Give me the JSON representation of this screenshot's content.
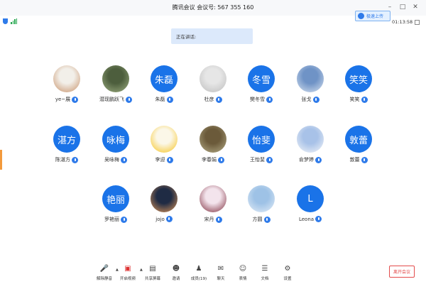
{
  "window": {
    "title": "腾讯会议 会议号: 567 355 160",
    "controls": [
      "minimize-icon",
      "maximize-icon",
      "close-icon"
    ]
  },
  "header": {
    "upload_button": "极速上传",
    "timer": "01:13:58",
    "speaking_label": "正在讲话:"
  },
  "participants": [
    {
      "name": "ye~展",
      "avatar": "photo-cartoon-child",
      "colors": [
        "#f2efe9",
        "#c68f66"
      ]
    },
    {
      "name": "潜现鹏跃飞",
      "avatar": "photo-forest",
      "colors": [
        "#4d5e3d",
        "#9fb083"
      ]
    },
    {
      "name": "朱磊",
      "avatar_text": "朱磊"
    },
    {
      "name": "杜彦",
      "avatar": "default-person",
      "colors": [
        "#e6e6e6",
        "#bdbdbd"
      ]
    },
    {
      "name": "樊冬雪",
      "avatar_text": "冬雪"
    },
    {
      "name": "张戈",
      "avatar": "photo-sky-clouds",
      "colors": [
        "#6f93c6",
        "#d9e3f0"
      ]
    },
    {
      "name": "笑笑",
      "avatar_text": "笑笑"
    },
    {
      "name": "陈湛方",
      "avatar_text": "湛方"
    },
    {
      "name": "吴咏梅",
      "avatar_text": "咏梅"
    },
    {
      "name": "李迎",
      "avatar": "photo-sun-cartoon",
      "colors": [
        "#fbf7e8",
        "#f6c21b"
      ]
    },
    {
      "name": "李春娟",
      "avatar": "photo-forest-trees",
      "colors": [
        "#6b5a3a",
        "#b6ae8a"
      ]
    },
    {
      "name": "王怡斐",
      "avatar_text": "怡斐"
    },
    {
      "name": "俞梦婷",
      "avatar": "photo-landmark-sky",
      "colors": [
        "#a8c2e8",
        "#f5f6f8"
      ]
    },
    {
      "name": "敦蕾",
      "avatar_text": "敦蕾"
    },
    {
      "name": "罗艳丽",
      "avatar_text": "艳丽"
    },
    {
      "name": "jojo",
      "avatar": "photo-sunset",
      "colors": [
        "#1f2b44",
        "#e39a5a"
      ]
    },
    {
      "name": "宋丹",
      "avatar": "photo-cartoon-girl",
      "colors": [
        "#f3e4ec",
        "#7b2a3a"
      ]
    },
    {
      "name": "方圆",
      "avatar": "photo-sky-blue",
      "colors": [
        "#9ec2e6",
        "#e5eef7"
      ]
    },
    {
      "name": "Leona",
      "avatar_text": "L"
    }
  ],
  "toolbar": {
    "items": [
      {
        "label": "解除静音",
        "icon": "mic-muted-icon"
      },
      {
        "label": "开启视频",
        "icon": "camera-off-icon"
      },
      {
        "label": "共享屏幕",
        "icon": "screen-share-icon"
      },
      {
        "label": "邀请",
        "icon": "invite-icon"
      },
      {
        "label": "成员(19)",
        "icon": "members-icon"
      },
      {
        "label": "聊天",
        "icon": "chat-icon"
      },
      {
        "label": "表情",
        "icon": "emoji-icon"
      },
      {
        "label": "文档",
        "icon": "document-icon"
      },
      {
        "label": "设置",
        "icon": "settings-icon"
      }
    ],
    "leave_button": "离开会议"
  },
  "colors": {
    "accent": "#1a73e8",
    "leave": "#e34b4b",
    "speaking_bg": "#dce9fb"
  }
}
